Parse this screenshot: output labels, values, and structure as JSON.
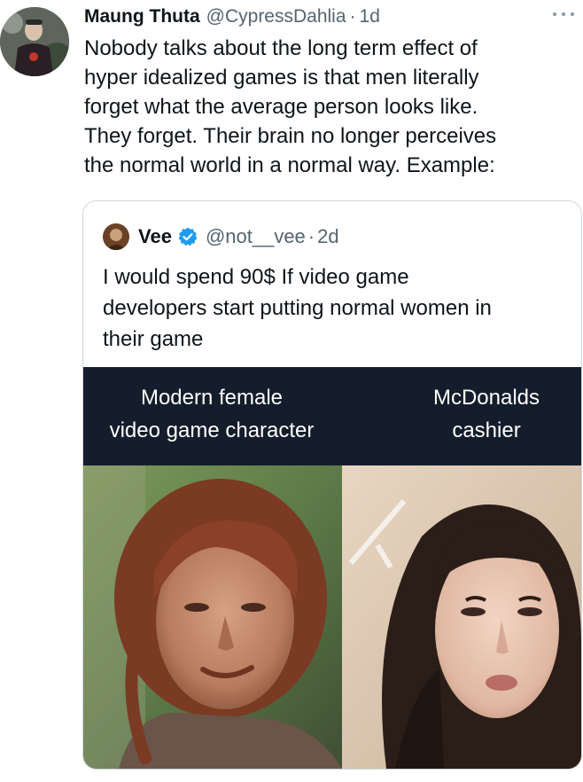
{
  "tweet": {
    "display_name": "Maung Thuta",
    "handle": "@CypressDahlia",
    "separator": "·",
    "time": "1d",
    "text": "Nobody talks about the long term effect of\nhyper idealized games is that men literally\nforget what the average person looks like.\nThey forget. Their brain no longer perceives\nthe normal world in a normal way. Example:",
    "more_icon": "more-horizontal-icon"
  },
  "quote": {
    "display_name": "Vee",
    "verified_icon": "verified-badge-icon",
    "handle": "@not__vee",
    "separator": "·",
    "time": "2d",
    "text": "I would spend 90$ If video game\ndevelopers start putting normal women in\ntheir game",
    "meme": {
      "left_caption": "Modern female\nvideo game character",
      "right_caption": "McDonalds\ncashier"
    }
  },
  "colors": {
    "text_primary": "#0f1419",
    "text_secondary": "#536471",
    "border": "#cfd9de",
    "verified": "#1d9bf0",
    "caption_band": "#141d2b"
  }
}
